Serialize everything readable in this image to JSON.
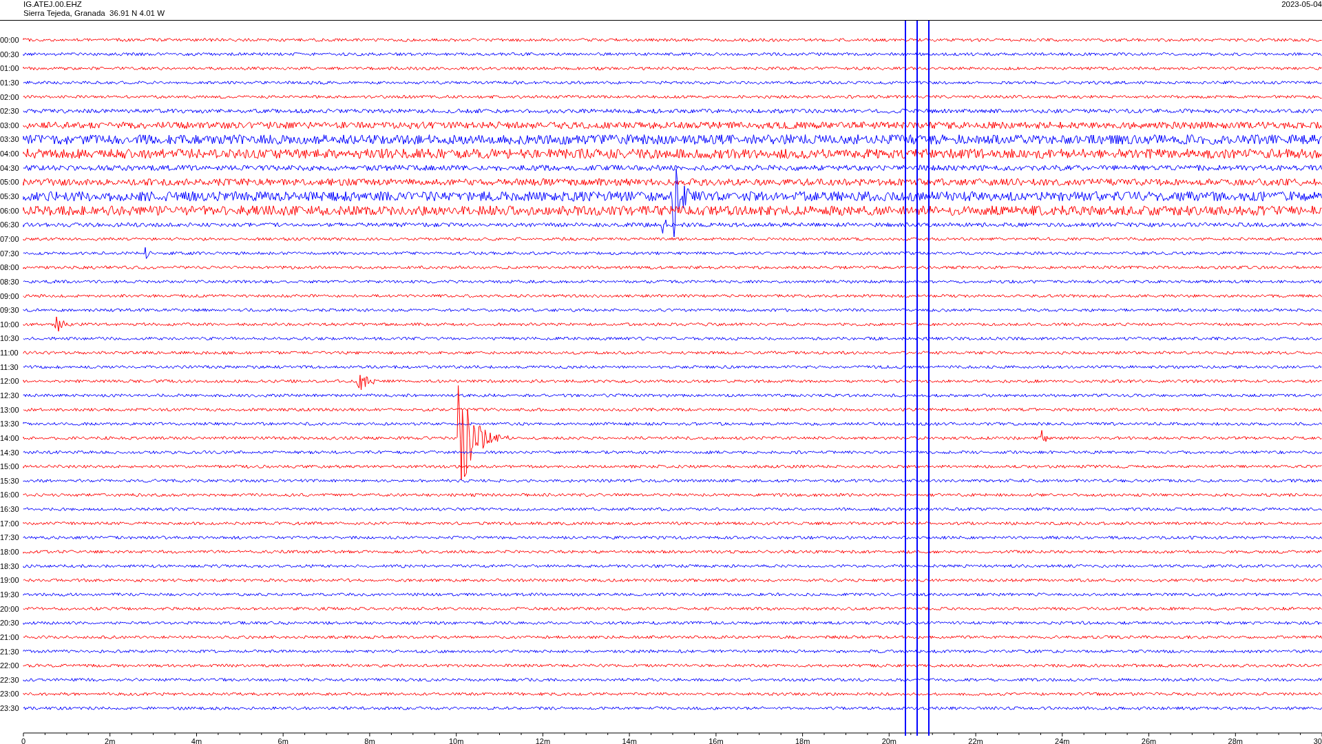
{
  "header": {
    "station": "IG.ATEJ.00.EHZ",
    "location": "Sierra Tejeda, Granada  36.91 N 4.01 W",
    "date": "2023-05-04"
  },
  "rows": [
    {
      "time": "00:00",
      "color": "#ff0000"
    },
    {
      "time": "00:30",
      "color": "#0000ff"
    },
    {
      "time": "01:00",
      "color": "#ff0000"
    },
    {
      "time": "01:30",
      "color": "#0000ff"
    },
    {
      "time": "02:00",
      "color": "#ff0000"
    },
    {
      "time": "02:30",
      "color": "#0000ff"
    },
    {
      "time": "03:00",
      "color": "#ff0000"
    },
    {
      "time": "03:30",
      "color": "#0000ff"
    },
    {
      "time": "04:00",
      "color": "#ff0000"
    },
    {
      "time": "04:30",
      "color": "#0000ff"
    },
    {
      "time": "05:00",
      "color": "#ff0000"
    },
    {
      "time": "05:30",
      "color": "#0000ff"
    },
    {
      "time": "06:00",
      "color": "#ff0000"
    },
    {
      "time": "06:30",
      "color": "#0000ff"
    },
    {
      "time": "07:00",
      "color": "#ff0000"
    },
    {
      "time": "07:30",
      "color": "#0000ff"
    },
    {
      "time": "08:00",
      "color": "#ff0000"
    },
    {
      "time": "08:30",
      "color": "#0000ff"
    },
    {
      "time": "09:00",
      "color": "#ff0000"
    },
    {
      "time": "09:30",
      "color": "#0000ff"
    },
    {
      "time": "10:00",
      "color": "#ff0000"
    },
    {
      "time": "10:30",
      "color": "#0000ff"
    },
    {
      "time": "11:00",
      "color": "#ff0000"
    },
    {
      "time": "11:30",
      "color": "#0000ff"
    },
    {
      "time": "12:00",
      "color": "#ff0000"
    },
    {
      "time": "12:30",
      "color": "#0000ff"
    },
    {
      "time": "13:00",
      "color": "#ff0000"
    },
    {
      "time": "13:30",
      "color": "#0000ff"
    },
    {
      "time": "14:00",
      "color": "#ff0000"
    },
    {
      "time": "14:30",
      "color": "#0000ff"
    },
    {
      "time": "15:00",
      "color": "#ff0000"
    },
    {
      "time": "15:30",
      "color": "#0000ff"
    },
    {
      "time": "16:00",
      "color": "#ff0000"
    },
    {
      "time": "16:30",
      "color": "#0000ff"
    },
    {
      "time": "17:00",
      "color": "#ff0000"
    },
    {
      "time": "17:30",
      "color": "#0000ff"
    },
    {
      "time": "18:00",
      "color": "#ff0000"
    },
    {
      "time": "18:30",
      "color": "#0000ff"
    },
    {
      "time": "19:00",
      "color": "#ff0000"
    },
    {
      "time": "19:30",
      "color": "#0000ff"
    },
    {
      "time": "20:00",
      "color": "#ff0000"
    },
    {
      "time": "20:30",
      "color": "#0000ff"
    },
    {
      "time": "21:00",
      "color": "#ff0000"
    },
    {
      "time": "21:30",
      "color": "#0000ff"
    },
    {
      "time": "22:00",
      "color": "#ff0000"
    },
    {
      "time": "22:30",
      "color": "#0000ff"
    },
    {
      "time": "23:00",
      "color": "#ff0000"
    },
    {
      "time": "23:30",
      "color": "#0000ff"
    }
  ],
  "x_axis": {
    "ticks": [
      "0",
      "2m",
      "4m",
      "6m",
      "8m",
      "10m",
      "12m",
      "14m",
      "16m",
      "18m",
      "20m",
      "22m",
      "24m",
      "26m",
      "28m",
      "30"
    ]
  }
}
